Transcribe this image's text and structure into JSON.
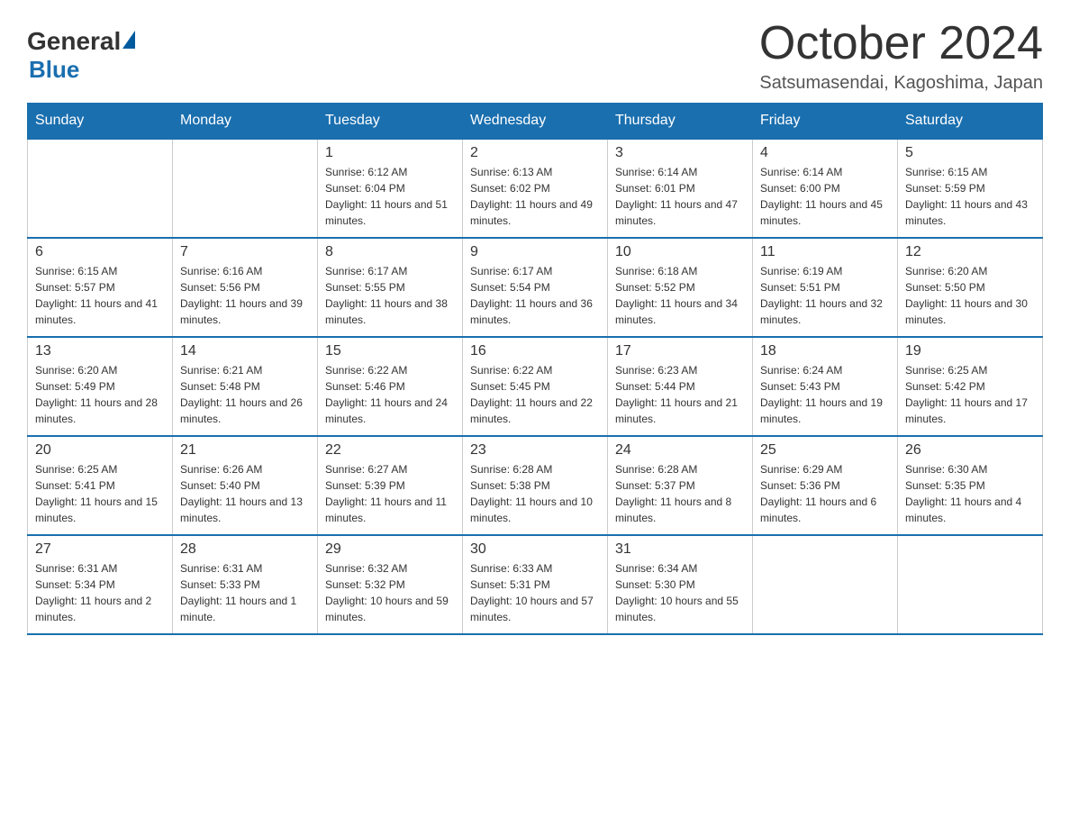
{
  "header": {
    "logo_general": "General",
    "logo_blue": "Blue",
    "month_title": "October 2024",
    "location": "Satsumasendai, Kagoshima, Japan"
  },
  "calendar": {
    "days_of_week": [
      "Sunday",
      "Monday",
      "Tuesday",
      "Wednesday",
      "Thursday",
      "Friday",
      "Saturday"
    ],
    "weeks": [
      [
        {
          "day": "",
          "sunrise": "",
          "sunset": "",
          "daylight": ""
        },
        {
          "day": "",
          "sunrise": "",
          "sunset": "",
          "daylight": ""
        },
        {
          "day": "1",
          "sunrise": "Sunrise: 6:12 AM",
          "sunset": "Sunset: 6:04 PM",
          "daylight": "Daylight: 11 hours and 51 minutes."
        },
        {
          "day": "2",
          "sunrise": "Sunrise: 6:13 AM",
          "sunset": "Sunset: 6:02 PM",
          "daylight": "Daylight: 11 hours and 49 minutes."
        },
        {
          "day": "3",
          "sunrise": "Sunrise: 6:14 AM",
          "sunset": "Sunset: 6:01 PM",
          "daylight": "Daylight: 11 hours and 47 minutes."
        },
        {
          "day": "4",
          "sunrise": "Sunrise: 6:14 AM",
          "sunset": "Sunset: 6:00 PM",
          "daylight": "Daylight: 11 hours and 45 minutes."
        },
        {
          "day": "5",
          "sunrise": "Sunrise: 6:15 AM",
          "sunset": "Sunset: 5:59 PM",
          "daylight": "Daylight: 11 hours and 43 minutes."
        }
      ],
      [
        {
          "day": "6",
          "sunrise": "Sunrise: 6:15 AM",
          "sunset": "Sunset: 5:57 PM",
          "daylight": "Daylight: 11 hours and 41 minutes."
        },
        {
          "day": "7",
          "sunrise": "Sunrise: 6:16 AM",
          "sunset": "Sunset: 5:56 PM",
          "daylight": "Daylight: 11 hours and 39 minutes."
        },
        {
          "day": "8",
          "sunrise": "Sunrise: 6:17 AM",
          "sunset": "Sunset: 5:55 PM",
          "daylight": "Daylight: 11 hours and 38 minutes."
        },
        {
          "day": "9",
          "sunrise": "Sunrise: 6:17 AM",
          "sunset": "Sunset: 5:54 PM",
          "daylight": "Daylight: 11 hours and 36 minutes."
        },
        {
          "day": "10",
          "sunrise": "Sunrise: 6:18 AM",
          "sunset": "Sunset: 5:52 PM",
          "daylight": "Daylight: 11 hours and 34 minutes."
        },
        {
          "day": "11",
          "sunrise": "Sunrise: 6:19 AM",
          "sunset": "Sunset: 5:51 PM",
          "daylight": "Daylight: 11 hours and 32 minutes."
        },
        {
          "day": "12",
          "sunrise": "Sunrise: 6:20 AM",
          "sunset": "Sunset: 5:50 PM",
          "daylight": "Daylight: 11 hours and 30 minutes."
        }
      ],
      [
        {
          "day": "13",
          "sunrise": "Sunrise: 6:20 AM",
          "sunset": "Sunset: 5:49 PM",
          "daylight": "Daylight: 11 hours and 28 minutes."
        },
        {
          "day": "14",
          "sunrise": "Sunrise: 6:21 AM",
          "sunset": "Sunset: 5:48 PM",
          "daylight": "Daylight: 11 hours and 26 minutes."
        },
        {
          "day": "15",
          "sunrise": "Sunrise: 6:22 AM",
          "sunset": "Sunset: 5:46 PM",
          "daylight": "Daylight: 11 hours and 24 minutes."
        },
        {
          "day": "16",
          "sunrise": "Sunrise: 6:22 AM",
          "sunset": "Sunset: 5:45 PM",
          "daylight": "Daylight: 11 hours and 22 minutes."
        },
        {
          "day": "17",
          "sunrise": "Sunrise: 6:23 AM",
          "sunset": "Sunset: 5:44 PM",
          "daylight": "Daylight: 11 hours and 21 minutes."
        },
        {
          "day": "18",
          "sunrise": "Sunrise: 6:24 AM",
          "sunset": "Sunset: 5:43 PM",
          "daylight": "Daylight: 11 hours and 19 minutes."
        },
        {
          "day": "19",
          "sunrise": "Sunrise: 6:25 AM",
          "sunset": "Sunset: 5:42 PM",
          "daylight": "Daylight: 11 hours and 17 minutes."
        }
      ],
      [
        {
          "day": "20",
          "sunrise": "Sunrise: 6:25 AM",
          "sunset": "Sunset: 5:41 PM",
          "daylight": "Daylight: 11 hours and 15 minutes."
        },
        {
          "day": "21",
          "sunrise": "Sunrise: 6:26 AM",
          "sunset": "Sunset: 5:40 PM",
          "daylight": "Daylight: 11 hours and 13 minutes."
        },
        {
          "day": "22",
          "sunrise": "Sunrise: 6:27 AM",
          "sunset": "Sunset: 5:39 PM",
          "daylight": "Daylight: 11 hours and 11 minutes."
        },
        {
          "day": "23",
          "sunrise": "Sunrise: 6:28 AM",
          "sunset": "Sunset: 5:38 PM",
          "daylight": "Daylight: 11 hours and 10 minutes."
        },
        {
          "day": "24",
          "sunrise": "Sunrise: 6:28 AM",
          "sunset": "Sunset: 5:37 PM",
          "daylight": "Daylight: 11 hours and 8 minutes."
        },
        {
          "day": "25",
          "sunrise": "Sunrise: 6:29 AM",
          "sunset": "Sunset: 5:36 PM",
          "daylight": "Daylight: 11 hours and 6 minutes."
        },
        {
          "day": "26",
          "sunrise": "Sunrise: 6:30 AM",
          "sunset": "Sunset: 5:35 PM",
          "daylight": "Daylight: 11 hours and 4 minutes."
        }
      ],
      [
        {
          "day": "27",
          "sunrise": "Sunrise: 6:31 AM",
          "sunset": "Sunset: 5:34 PM",
          "daylight": "Daylight: 11 hours and 2 minutes."
        },
        {
          "day": "28",
          "sunrise": "Sunrise: 6:31 AM",
          "sunset": "Sunset: 5:33 PM",
          "daylight": "Daylight: 11 hours and 1 minute."
        },
        {
          "day": "29",
          "sunrise": "Sunrise: 6:32 AM",
          "sunset": "Sunset: 5:32 PM",
          "daylight": "Daylight: 10 hours and 59 minutes."
        },
        {
          "day": "30",
          "sunrise": "Sunrise: 6:33 AM",
          "sunset": "Sunset: 5:31 PM",
          "daylight": "Daylight: 10 hours and 57 minutes."
        },
        {
          "day": "31",
          "sunrise": "Sunrise: 6:34 AM",
          "sunset": "Sunset: 5:30 PM",
          "daylight": "Daylight: 10 hours and 55 minutes."
        },
        {
          "day": "",
          "sunrise": "",
          "sunset": "",
          "daylight": ""
        },
        {
          "day": "",
          "sunrise": "",
          "sunset": "",
          "daylight": ""
        }
      ]
    ]
  }
}
